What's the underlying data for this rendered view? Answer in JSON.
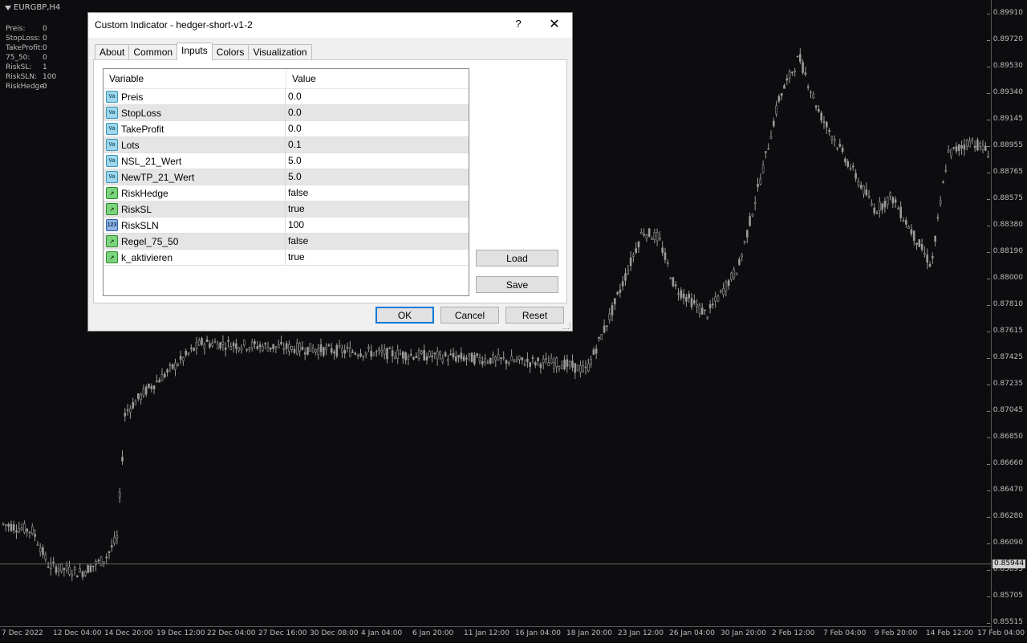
{
  "chart": {
    "symbol": "EURGBP,H4",
    "info": [
      {
        "label": "Preis:",
        "value": "0"
      },
      {
        "label": "StopLoss:",
        "value": "0"
      },
      {
        "label": "TakeProfit:",
        "value": "0"
      },
      {
        "label": "75_50:",
        "value": "0"
      },
      {
        "label": "RiskSL:",
        "value": "1"
      },
      {
        "label": "RiskSLN:",
        "value": "100"
      },
      {
        "label": "RiskHedge:",
        "value": "0"
      }
    ],
    "y_ticks": [
      "0.89910",
      "0.89720",
      "0.89530",
      "0.89340",
      "0.89145",
      "0.88955",
      "0.88765",
      "0.88575",
      "0.88380",
      "0.88190",
      "0.88000",
      "0.87810",
      "0.87615",
      "0.87425",
      "0.87235",
      "0.87045",
      "0.86850",
      "0.86660",
      "0.86470",
      "0.86280",
      "0.86090",
      "0.85895",
      "0.85705",
      "0.85515"
    ],
    "x_ticks": [
      "7 Dec 2022",
      "12 Dec 04:00",
      "14 Dec 20:00",
      "19 Dec 12:00",
      "22 Dec 04:00",
      "27 Dec 16:00",
      "30 Dec 08:00",
      "4 Jan 04:00",
      "6 Jan 20:00",
      "11 Jan 12:00",
      "16 Jan 04:00",
      "18 Jan 20:00",
      "23 Jan 12:00",
      "26 Jan 04:00",
      "30 Jan 20:00",
      "2 Feb 12:00",
      "7 Feb 04:00",
      "9 Feb 20:00",
      "14 Feb 12:00",
      "17 Feb 04:00"
    ],
    "current_price": "0.85944",
    "candle_color": "#9a9a9a"
  },
  "dialog": {
    "title": "Custom Indicator - hedger-short-v1-2",
    "help_icon": "?",
    "close_icon": "✕",
    "tabs": [
      "About",
      "Common",
      "Inputs",
      "Colors",
      "Visualization"
    ],
    "active_tab": "Inputs",
    "columns": {
      "variable": "Variable",
      "value": "Value"
    },
    "rows": [
      {
        "icon": "var",
        "name": "Preis",
        "value": "0.0"
      },
      {
        "icon": "var",
        "name": "StopLoss",
        "value": "0.0"
      },
      {
        "icon": "var",
        "name": "TakeProfit",
        "value": "0.0"
      },
      {
        "icon": "var",
        "name": "Lots",
        "value": "0.1"
      },
      {
        "icon": "var",
        "name": "NSL_21_Wert",
        "value": "5.0"
      },
      {
        "icon": "var",
        "name": "NewTP_21_Wert",
        "value": "5.0"
      },
      {
        "icon": "bool",
        "name": "RiskHedge",
        "value": "false"
      },
      {
        "icon": "bool",
        "name": "RiskSL",
        "value": "true"
      },
      {
        "icon": "int",
        "name": "RiskSLN",
        "value": "100"
      },
      {
        "icon": "bool",
        "name": "Regel_75_50",
        "value": "false"
      },
      {
        "icon": "bool",
        "name": "k_aktivieren",
        "value": "true"
      }
    ],
    "buttons": {
      "load": "Load",
      "save": "Save",
      "ok": "OK",
      "cancel": "Cancel",
      "reset": "Reset"
    }
  }
}
